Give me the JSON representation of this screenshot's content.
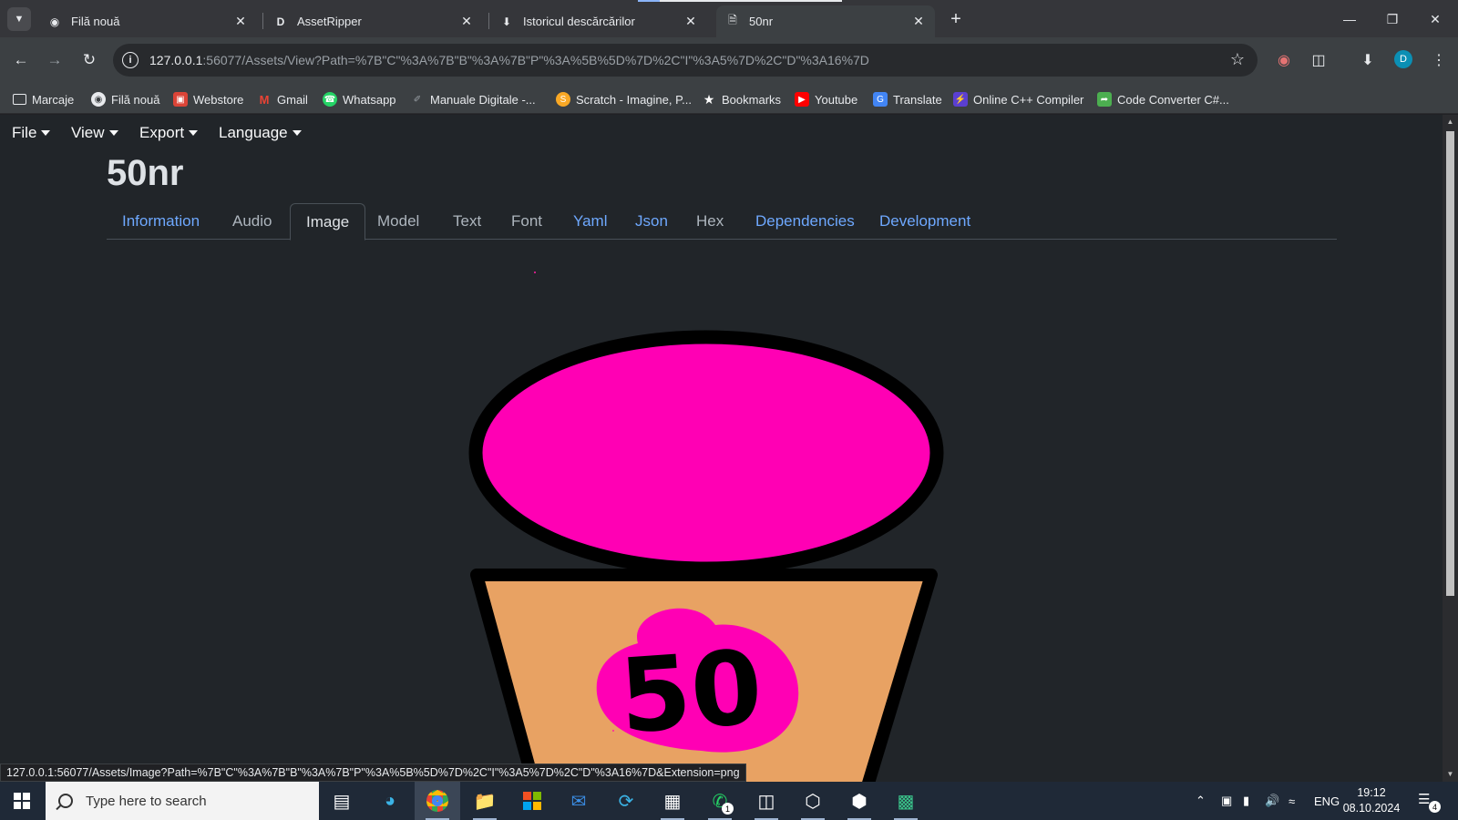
{
  "browser": {
    "tabs": [
      {
        "title": "Filă nouă",
        "icon": "chrome-icon",
        "active": false
      },
      {
        "title": "AssetRipper",
        "icon": "assetripper-icon",
        "active": false
      },
      {
        "title": "Istoricul descărcărilor",
        "icon": "download-icon",
        "active": false
      },
      {
        "title": "50nr",
        "icon": "page-icon",
        "active": true
      }
    ],
    "url_host": "127.0.0.1",
    "url_rest": ":56077/Assets/View?Path=%7B\"C\"%3A%7B\"B\"%3A%7B\"P\"%3A%5B%5D%7D%2C\"I\"%3A5%7D%2C\"D\"%3A16%7D",
    "profile_initial": "D",
    "bookmarks": [
      {
        "label": "Marcaje",
        "icon": "folder-icon"
      },
      {
        "label": "Filă nouă",
        "icon": "chrome-icon"
      },
      {
        "label": "Webstore",
        "icon": "webstore-icon"
      },
      {
        "label": "Gmail",
        "icon": "gmail-icon"
      },
      {
        "label": "Whatsapp",
        "icon": "whatsapp-icon"
      },
      {
        "label": "Manuale Digitale -...",
        "icon": "manuale-icon"
      },
      {
        "label": "Scratch - Imagine, P...",
        "icon": "scratch-icon"
      },
      {
        "label": "Bookmarks",
        "icon": "star-icon"
      },
      {
        "label": "Youtube",
        "icon": "youtube-icon"
      },
      {
        "label": "Translate",
        "icon": "translate-icon"
      },
      {
        "label": "Online C++ Compiler",
        "icon": "compiler-icon"
      },
      {
        "label": "Code Converter C#...",
        "icon": "converter-icon"
      }
    ],
    "status_url": "127.0.0.1:56077/Assets/Image?Path=%7B\"C\"%3A%7B\"B\"%3A%7B\"P\"%3A%5B%5D%7D%2C\"I\"%3A5%7D%2C\"D\"%3A16%7D&Extension=png"
  },
  "app": {
    "menus": [
      {
        "label": "File"
      },
      {
        "label": "View"
      },
      {
        "label": "Export"
      },
      {
        "label": "Language"
      }
    ],
    "asset_title": "50nr",
    "tabs": [
      {
        "label": "Information",
        "state": "link"
      },
      {
        "label": "Audio",
        "state": "disabled"
      },
      {
        "label": "Image",
        "state": "active"
      },
      {
        "label": "Model",
        "state": "disabled"
      },
      {
        "label": "Text",
        "state": "disabled"
      },
      {
        "label": "Font",
        "state": "disabled"
      },
      {
        "label": "Yaml",
        "state": "link"
      },
      {
        "label": "Json",
        "state": "link"
      },
      {
        "label": "Hex",
        "state": "disabled"
      },
      {
        "label": "Dependencies",
        "state": "link"
      },
      {
        "label": "Development",
        "state": "link"
      }
    ],
    "image_text": "50",
    "colors": {
      "link": "#6ea8fe",
      "cup_lid": "#ff00b4",
      "cup_body": "#e8a263",
      "page_bg": "#212529"
    }
  },
  "taskbar": {
    "search_placeholder": "Type here to search",
    "apps": [
      {
        "name": "task-view-icon"
      },
      {
        "name": "edge-icon"
      },
      {
        "name": "chrome-icon"
      },
      {
        "name": "file-explorer-icon"
      },
      {
        "name": "store-icon"
      },
      {
        "name": "mail-icon"
      },
      {
        "name": "refresh-app-icon"
      },
      {
        "name": "app-window-icon"
      },
      {
        "name": "whatsapp-icon",
        "badge": "1"
      },
      {
        "name": "app-explorer-icon"
      },
      {
        "name": "unity-icon"
      },
      {
        "name": "unity-hub-icon"
      },
      {
        "name": "app-green-icon"
      }
    ],
    "language": "ENG",
    "time": "19:12",
    "date": "08.10.2024",
    "notifications": "4"
  }
}
